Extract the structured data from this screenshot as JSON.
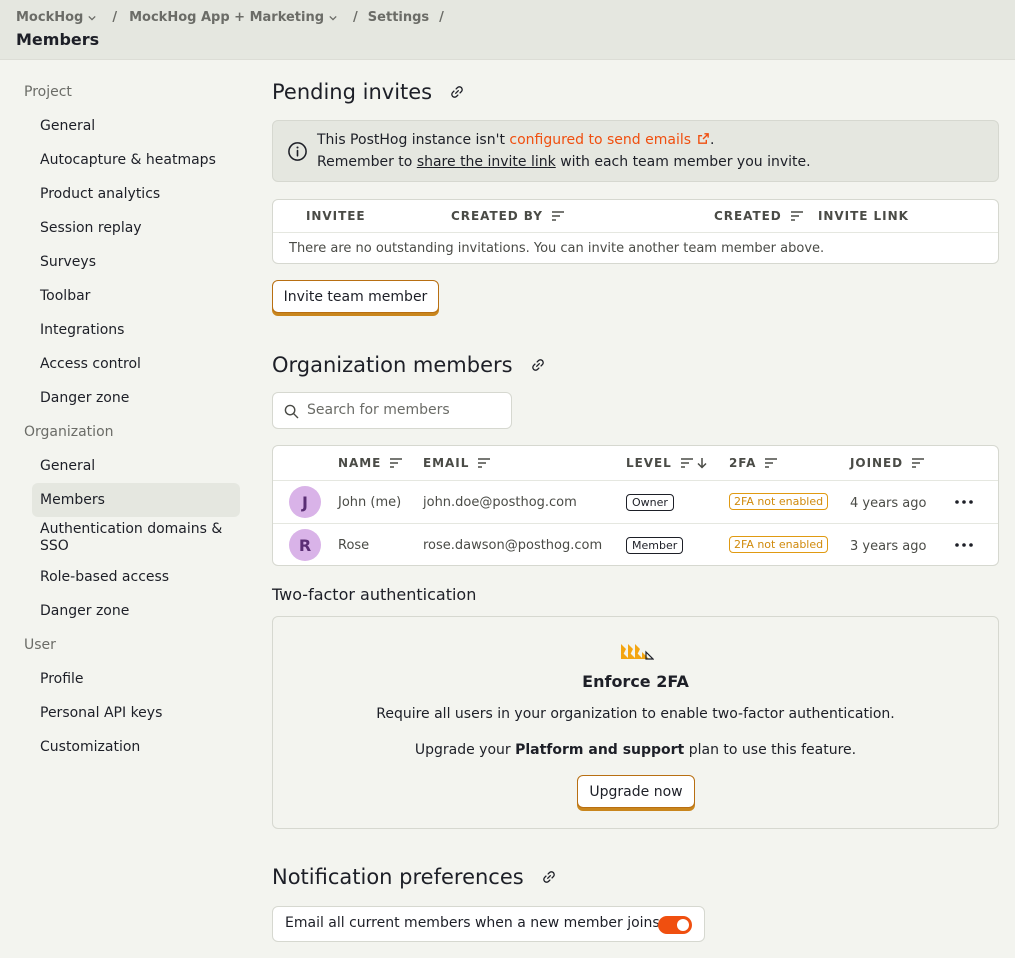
{
  "breadcrumbs": {
    "org": "MockHog",
    "project": "MockHog App + Marketing",
    "settings": "Settings",
    "title": "Members"
  },
  "sidebar": {
    "project_heading": "Project",
    "project_items": [
      "General",
      "Autocapture & heatmaps",
      "Product analytics",
      "Session replay",
      "Surveys",
      "Toolbar",
      "Integrations",
      "Access control",
      "Danger zone"
    ],
    "org_heading": "Organization",
    "org_items": [
      "General",
      "Members",
      "Authentication domains & SSO",
      "Role-based access",
      "Danger zone"
    ],
    "user_heading": "User",
    "user_items": [
      "Profile",
      "Personal API keys",
      "Customization"
    ]
  },
  "pending": {
    "title": "Pending invites",
    "banner_pre": "This PostHog instance isn't ",
    "banner_link": "configured to send emails",
    "banner_post": ".",
    "banner2_pre": "Remember to ",
    "banner2_link": "share the invite link",
    "banner2_post": " with each team member you invite.",
    "columns": [
      "INVITEE",
      "CREATED BY",
      "CREATED",
      "INVITE LINK"
    ],
    "empty": "There are no outstanding invitations. You can invite another team member above.",
    "invite_button": "Invite team member"
  },
  "members": {
    "title": "Organization members",
    "search_placeholder": "Search for members",
    "columns": [
      "NAME",
      "EMAIL",
      "LEVEL",
      "2FA",
      "JOINED"
    ],
    "rows": [
      {
        "initial": "J",
        "name": "John (me)",
        "email": "john.doe@posthog.com",
        "level": "Owner",
        "tfa": "2FA not enabled",
        "joined": "4 years ago"
      },
      {
        "initial": "R",
        "name": "Rose",
        "email": "rose.dawson@posthog.com",
        "level": "Member",
        "tfa": "2FA not enabled",
        "joined": "3 years ago"
      }
    ]
  },
  "two_factor": {
    "title": "Two-factor authentication",
    "card_title": "Enforce 2FA",
    "desc": "Require all users in your organization to enable two-factor authentication.",
    "upgrade_pre": "Upgrade your ",
    "upgrade_bold": "Platform and support",
    "upgrade_post": " plan to use this feature.",
    "button": "Upgrade now"
  },
  "notifications": {
    "title": "Notification preferences",
    "label": "Email all current members when a new member joins",
    "enabled": true
  },
  "colors": {
    "accent": "#f04f0f",
    "warning": "#e09a12",
    "bg": "#f3f4ef"
  }
}
